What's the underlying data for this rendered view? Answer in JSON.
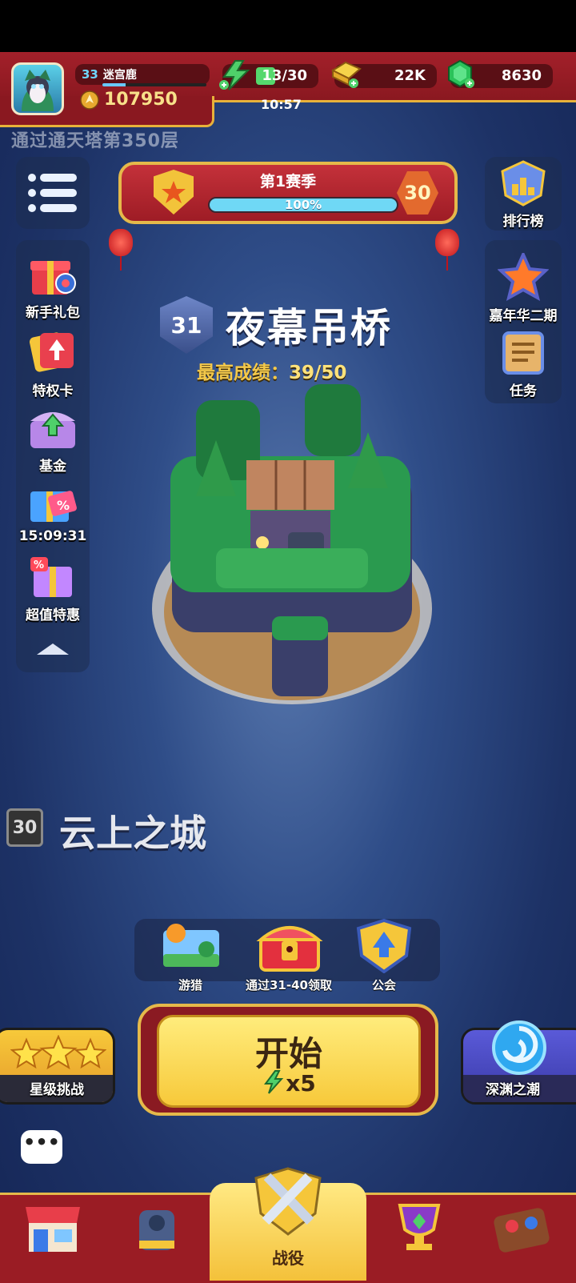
{
  "player": {
    "level": "33",
    "name": "迷宫鹿",
    "xp_progress": 0.22,
    "gold": "107950"
  },
  "resources": {
    "energy": "13/30",
    "energy_timer": "10:57",
    "coins": "22K",
    "gems": "8630"
  },
  "tower_notice": "通过通天塔第350层",
  "season": {
    "title": "第1赛季",
    "progress": "100%",
    "tier": "30"
  },
  "left_menu": [
    {
      "label": "新手礼包",
      "icon": "gift-box-icon"
    },
    {
      "label": "特权卡",
      "icon": "privilege-card-icon"
    },
    {
      "label": "基金",
      "icon": "fund-chest-icon"
    },
    {
      "label": "15:09:31",
      "icon": "discount-gift-icon"
    },
    {
      "label": "超值特惠",
      "icon": "value-deal-icon"
    }
  ],
  "right_menu": [
    {
      "label": "排行榜",
      "icon": "leaderboard-icon"
    },
    {
      "label": "嘉年华二期",
      "icon": "carnival-star-icon"
    },
    {
      "label": "任务",
      "icon": "task-list-icon"
    }
  ],
  "current_level": {
    "number": "31",
    "name": "夜幕吊桥",
    "best_label": "最高成绩：",
    "best_value": "39/50"
  },
  "previous_level": {
    "number": "30",
    "name": "云上之城"
  },
  "shortcuts": [
    {
      "label": "游猎",
      "icon": "safari-icon"
    },
    {
      "label": "通过31-40领取",
      "icon": "treasure-chest-icon"
    },
    {
      "label": "公会",
      "icon": "guild-shield-icon"
    }
  ],
  "start_button": {
    "label": "开始",
    "cost": "x5"
  },
  "side_buttons": {
    "left": "星级挑战",
    "right": "深渊之潮"
  },
  "bottom_nav": {
    "active_label": "战役"
  },
  "colors": {
    "header_red": "#a3202a",
    "gold_trim": "#e5b94a",
    "start_yellow": "#f7c93a"
  }
}
